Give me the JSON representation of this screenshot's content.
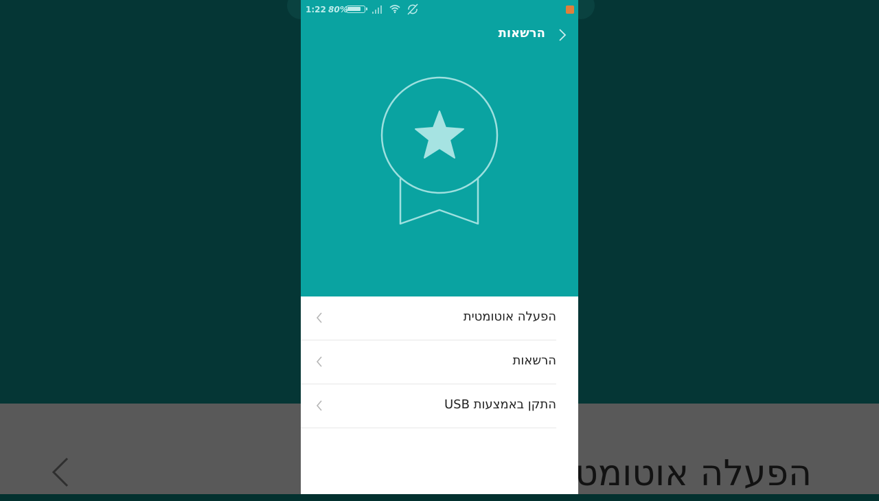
{
  "status_bar": {
    "time": "1:22",
    "battery_percent": "80%",
    "battery_level": 0.8,
    "icons": [
      "battery-icon",
      "signal-icon",
      "wifi-icon",
      "sync-disabled-icon",
      "screen-record-icon"
    ]
  },
  "header": {
    "title": "הרשאות",
    "back_icon": "chevron-back-icon"
  },
  "hero": {
    "icon": "award-ribbon-star-icon",
    "background": "#0aa3a1"
  },
  "menu": {
    "items": [
      {
        "label": "הפעלה אוטומטית",
        "icon": "chevron-right-icon"
      },
      {
        "label": "הרשאות",
        "icon": "chevron-right-icon"
      },
      {
        "label": "התקן באמצעות USB",
        "icon": "chevron-right-icon"
      }
    ]
  },
  "background": {
    "blurred_text": "הפעלה אוטומטית",
    "colors": {
      "top": "#053635",
      "bottom": "#595959"
    }
  }
}
